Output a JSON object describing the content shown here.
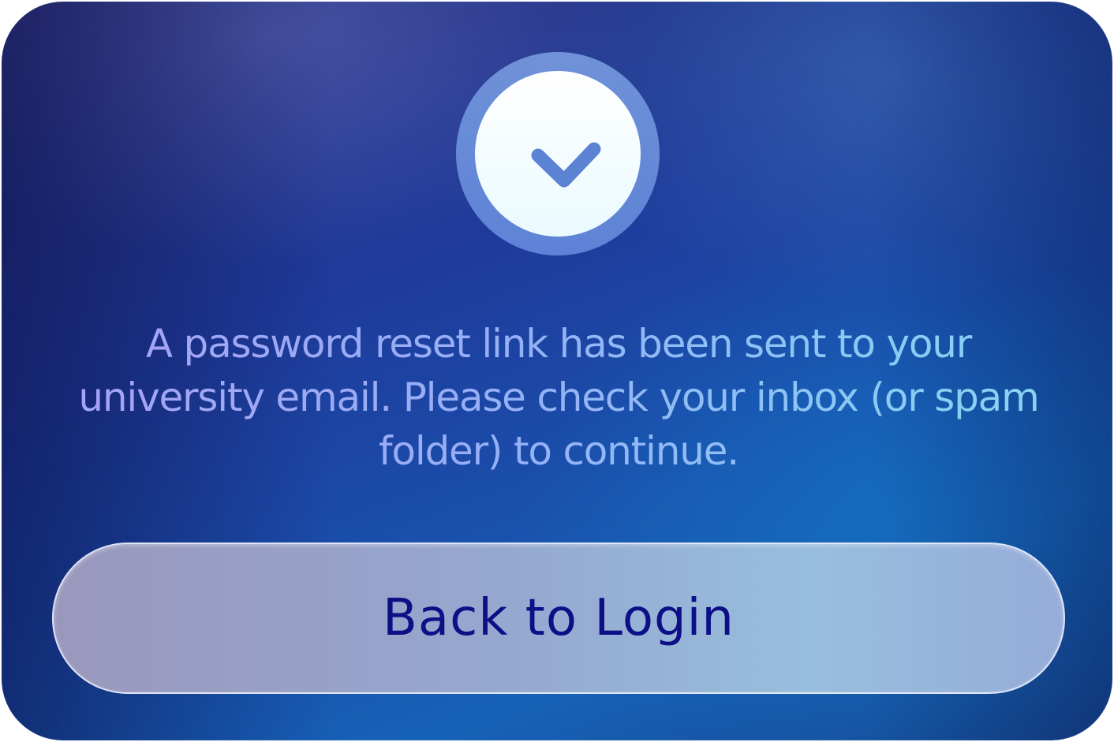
{
  "confirmation": {
    "icon": "checkmark-icon",
    "message": "A password reset link has been sent to your university email. Please check your inbox (or spam folder) to continue.",
    "button_label": "Back to Login"
  },
  "colors": {
    "background_start": "#2a2f7a",
    "background_end": "#1662b8",
    "icon_ring": "#6f92d8",
    "checkmark": "#5b82d3",
    "button_text": "#0d0f86"
  }
}
